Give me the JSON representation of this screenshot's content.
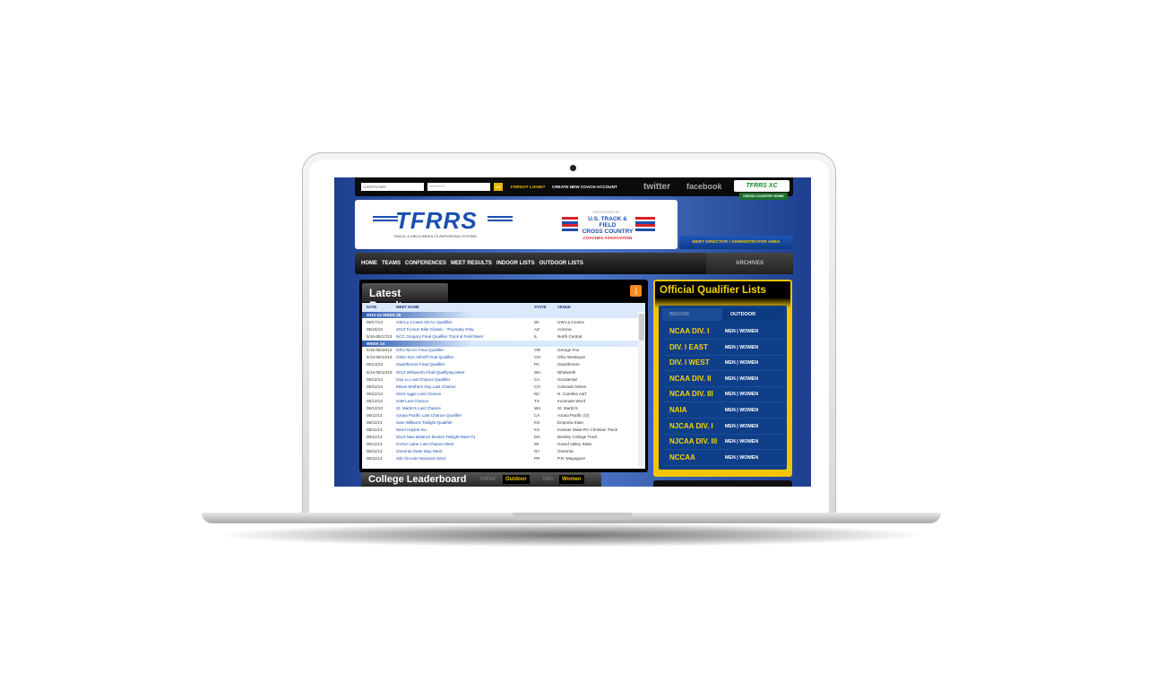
{
  "topbar": {
    "username_placeholder": "USERNAME:",
    "password_value": "**********",
    "go": "GO",
    "forgot": "FORGOT LOGIN?",
    "create": "CREATE NEW COACH ACCOUNT",
    "twitter": "twitter",
    "facebook": "facebook",
    "xc_logo": "TFRRS XC",
    "xc_home": "CROSS COUNTRY HOME"
  },
  "header": {
    "logo": "TFRRS",
    "logo_sub": "TRACK & FIELD RESULTS REPORTING SYSTEM",
    "presented": "PRESENTED BY",
    "sponsor1": "U.S. TRACK & FIELD",
    "sponsor2": "CROSS COUNTRY",
    "sponsor_and": "AND",
    "sponsor3": "COACHES ASSOCIATION",
    "meet_director": "MEET DIRECTOR / ADMINISTRATOR AREA"
  },
  "nav": {
    "items": [
      "HOME",
      "TEAMS",
      "CONFERENCES",
      "MEET RESULTS",
      "INDOOR LISTS",
      "OUTDOOR LISTS"
    ],
    "archives": "ARCHIVES"
  },
  "latest": {
    "title": "Latest Results",
    "columns": [
      "DATE",
      "MEET NAME",
      "STATE",
      "VENUE"
    ],
    "groups": [
      {
        "week": "2012-13 WEEK 25",
        "rows": [
          [
            "05/17/13",
            "UW-La Crosse NCAA Qualifier",
            "WI",
            "UW-La Crosse"
          ],
          [
            "05/16/13",
            "2013 Tucson Elite Classic - Thursday Only",
            "AZ",
            "Arizona"
          ],
          [
            "5/16-05/17/13",
            "NCC Gregory Final Qualifier Track & Field Meet",
            "IL",
            "North Central"
          ]
        ]
      },
      {
        "week": "WEEK 24",
        "rows": [
          [
            "5/15-05/16/13",
            "GFU NCAA Final Qualifier",
            "OR",
            "George Fox"
          ],
          [
            "5/13-05/14/13",
            "OWU Ron Althoff Final Qualifier",
            "OH",
            "Ohio Wesleyan"
          ],
          [
            "05/13/13",
            "Swarthmore Final Qualifier",
            "PA",
            "Swarthmore"
          ],
          [
            "5/13-05/14/13",
            "2013 Whitworth Final Qualifying Meet",
            "WA",
            "Whitworth"
          ],
          [
            "05/12/13",
            "Oxy-Lu Last Chance Qualifier",
            "CA",
            "Occidental"
          ],
          [
            "05/12/13",
            "Mines Mothers Day Last Chance",
            "CO",
            "Colorado Mines"
          ],
          [
            "05/12/13",
            "2013 Aggie Last Chance",
            "NC",
            "N. Carolina A&T"
          ],
          [
            "05/12/13",
            "UIW Last Chance",
            "TX",
            "Incarnate Word"
          ],
          [
            "05/12/13",
            "St. Martin's Last Chance",
            "WA",
            "St. Martin's"
          ],
          [
            "05/11/13",
            "Azusa Pacific Last Chance Qualifier",
            "CA",
            "Azusa Pacific (O)"
          ],
          [
            "05/11/13",
            "Sam Williams Twilight Qualifier",
            "KS",
            "Emporia State"
          ],
          [
            "05/11/13",
            "Ward Haylett Inv",
            "KS",
            "Kansas State-RV Christian Track"
          ],
          [
            "05/11/13",
            "2013 New Balance Boston Twilight Meet #1",
            "MA",
            "Bentley College Track"
          ],
          [
            "05/11/13",
            "GVSU Laker Last Chance Meet",
            "MI",
            "Grand Valley State"
          ],
          [
            "05/11/13",
            "Oneonta State May Meet",
            "NY",
            "Oneonta"
          ],
          [
            "05/11/13",
            "2do Circuito Nacional 2013",
            "PR",
            "P.R.-Mayaguez"
          ]
        ]
      }
    ]
  },
  "leaderboard": {
    "title": "College Leaderboard",
    "indoor": "Indoor",
    "outdoor": "Outdoor",
    "men": "Men",
    "women": "Women"
  },
  "qualifier": {
    "title": "Official Qualifier Lists",
    "tabs": [
      "INDOOR",
      "OUTDOOR"
    ],
    "active_tab": "OUTDOOR",
    "men": "MEN",
    "sep": "|",
    "women": "WOMEN",
    "divisions": [
      "NCAA DIV. I",
      "DIV. I EAST",
      "DIV. I WEST",
      "NCAA DIV. II",
      "NCAA DIV. III",
      "NAIA",
      "NJCAA DIV. I",
      "NJCAA DIV. III",
      "NCCAA"
    ]
  },
  "colors": {
    "accent_yellow": "#f5c400",
    "navy": "#0f3f88",
    "background_blue": "#2a55a8"
  }
}
